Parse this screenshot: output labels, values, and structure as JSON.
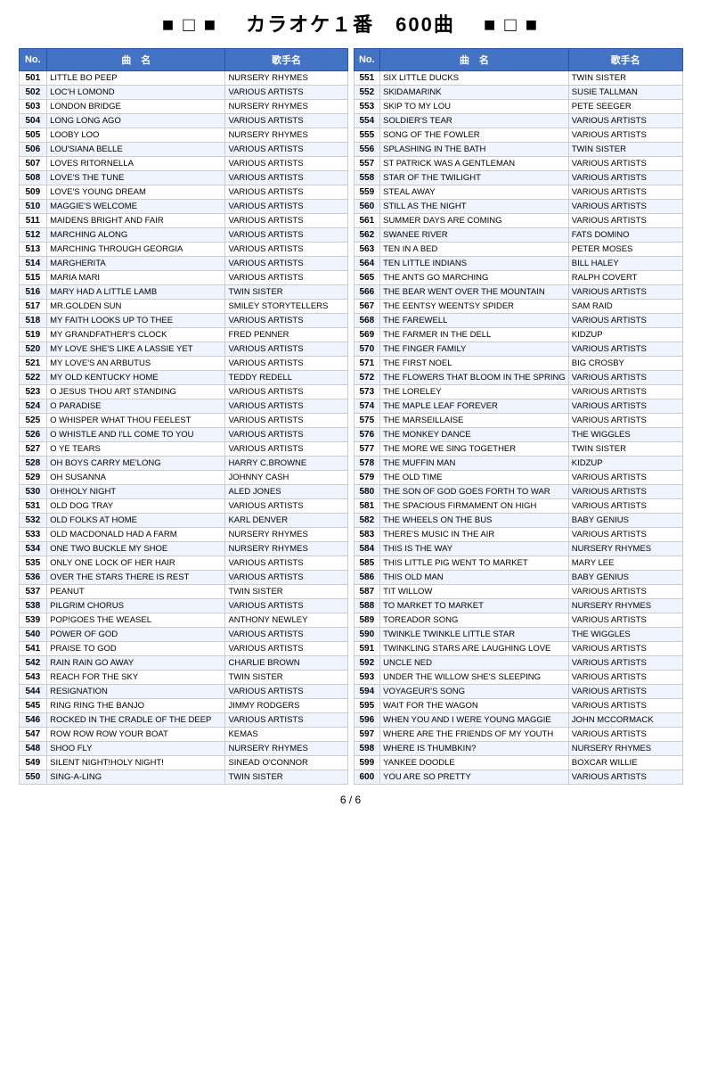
{
  "header": {
    "title": "カラオケ１番　600曲",
    "symbols_left": "■ □ ■",
    "symbols_right": "■ □ ■"
  },
  "footer": {
    "page": "6 / 6"
  },
  "columns": {
    "no": "No.",
    "song": "曲　名",
    "artist": "歌手名"
  },
  "left_table": [
    {
      "no": "501",
      "song": "LITTLE BO PEEP",
      "artist": "NURSERY RHYMES"
    },
    {
      "no": "502",
      "song": "LOC'H LOMOND",
      "artist": "VARIOUS ARTISTS"
    },
    {
      "no": "503",
      "song": "LONDON BRIDGE",
      "artist": "NURSERY RHYMES"
    },
    {
      "no": "504",
      "song": "LONG LONG AGO",
      "artist": "VARIOUS ARTISTS"
    },
    {
      "no": "505",
      "song": "LOOBY LOO",
      "artist": "NURSERY RHYMES"
    },
    {
      "no": "506",
      "song": "LOU'SIANA BELLE",
      "artist": "VARIOUS ARTISTS"
    },
    {
      "no": "507",
      "song": "LOVES RITORNELLA",
      "artist": "VARIOUS ARTISTS"
    },
    {
      "no": "508",
      "song": "LOVE'S THE TUNE",
      "artist": "VARIOUS ARTISTS"
    },
    {
      "no": "509",
      "song": "LOVE'S YOUNG DREAM",
      "artist": "VARIOUS ARTISTS"
    },
    {
      "no": "510",
      "song": "MAGGIE'S WELCOME",
      "artist": "VARIOUS ARTISTS"
    },
    {
      "no": "511",
      "song": "MAIDENS BRIGHT AND FAIR",
      "artist": "VARIOUS ARTISTS"
    },
    {
      "no": "512",
      "song": "MARCHING ALONG",
      "artist": "VARIOUS ARTISTS"
    },
    {
      "no": "513",
      "song": "MARCHING THROUGH GEORGIA",
      "artist": "VARIOUS ARTISTS"
    },
    {
      "no": "514",
      "song": "MARGHERITA",
      "artist": "VARIOUS ARTISTS"
    },
    {
      "no": "515",
      "song": "MARIA MARI",
      "artist": "VARIOUS ARTISTS"
    },
    {
      "no": "516",
      "song": "MARY HAD A LITTLE LAMB",
      "artist": "TWIN SISTER"
    },
    {
      "no": "517",
      "song": "MR.GOLDEN SUN",
      "artist": "SMILEY STORYTELLERS"
    },
    {
      "no": "518",
      "song": "MY FAITH LOOKS UP TO THEE",
      "artist": "VARIOUS ARTISTS"
    },
    {
      "no": "519",
      "song": "MY GRANDFATHER'S CLOCK",
      "artist": "FRED PENNER"
    },
    {
      "no": "520",
      "song": "MY LOVE SHE'S LIKE A LASSIE YET",
      "artist": "VARIOUS ARTISTS"
    },
    {
      "no": "521",
      "song": "MY LOVE'S AN ARBUTUS",
      "artist": "VARIOUS ARTISTS"
    },
    {
      "no": "522",
      "song": "MY OLD KENTUCKY HOME",
      "artist": "TEDDY REDELL"
    },
    {
      "no": "523",
      "song": "O JESUS THOU ART STANDING",
      "artist": "VARIOUS ARTISTS"
    },
    {
      "no": "524",
      "song": "O PARADISE",
      "artist": "VARIOUS ARTISTS"
    },
    {
      "no": "525",
      "song": "O WHISPER WHAT THOU FEELEST",
      "artist": "VARIOUS ARTISTS"
    },
    {
      "no": "526",
      "song": "O WHISTLE AND I'LL COME TO YOU",
      "artist": "VARIOUS ARTISTS"
    },
    {
      "no": "527",
      "song": "O YE TEARS",
      "artist": "VARIOUS ARTISTS"
    },
    {
      "no": "528",
      "song": "OH BOYS CARRY ME'LONG",
      "artist": "HARRY C.BROWNE"
    },
    {
      "no": "529",
      "song": "OH SUSANNA",
      "artist": "JOHNNY CASH"
    },
    {
      "no": "530",
      "song": "OH!HOLY NIGHT",
      "artist": "ALED JONES"
    },
    {
      "no": "531",
      "song": "OLD DOG TRAY",
      "artist": "VARIOUS ARTISTS"
    },
    {
      "no": "532",
      "song": "OLD FOLKS AT HOME",
      "artist": "KARL DENVER"
    },
    {
      "no": "533",
      "song": "OLD MACDONALD HAD A FARM",
      "artist": "NURSERY RHYMES"
    },
    {
      "no": "534",
      "song": "ONE TWO BUCKLE MY SHOE",
      "artist": "NURSERY RHYMES"
    },
    {
      "no": "535",
      "song": "ONLY ONE LOCK OF HER HAIR",
      "artist": "VARIOUS ARTISTS"
    },
    {
      "no": "536",
      "song": "OVER THE STARS THERE IS REST",
      "artist": "VARIOUS ARTISTS"
    },
    {
      "no": "537",
      "song": "PEANUT",
      "artist": "TWIN SISTER"
    },
    {
      "no": "538",
      "song": "PILGRIM CHORUS",
      "artist": "VARIOUS ARTISTS"
    },
    {
      "no": "539",
      "song": "POP!GOES THE WEASEL",
      "artist": "ANTHONY NEWLEY"
    },
    {
      "no": "540",
      "song": "POWER OF GOD",
      "artist": "VARIOUS ARTISTS"
    },
    {
      "no": "541",
      "song": "PRAISE TO GOD",
      "artist": "VARIOUS ARTISTS"
    },
    {
      "no": "542",
      "song": "RAIN RAIN GO AWAY",
      "artist": "CHARLIE BROWN"
    },
    {
      "no": "543",
      "song": "REACH FOR THE SKY",
      "artist": "TWIN SISTER"
    },
    {
      "no": "544",
      "song": "RESIGNATION",
      "artist": "VARIOUS ARTISTS"
    },
    {
      "no": "545",
      "song": "RING RING THE BANJO",
      "artist": "JIMMY RODGERS"
    },
    {
      "no": "546",
      "song": "ROCKED IN THE CRADLE OF THE DEEP",
      "artist": "VARIOUS ARTISTS"
    },
    {
      "no": "547",
      "song": "ROW ROW ROW YOUR BOAT",
      "artist": "KEMAS"
    },
    {
      "no": "548",
      "song": "SHOO FLY",
      "artist": "NURSERY RHYMES"
    },
    {
      "no": "549",
      "song": "SILENT NIGHT!HOLY NIGHT!",
      "artist": "SINEAD O'CONNOR"
    },
    {
      "no": "550",
      "song": "SING-A-LING",
      "artist": "TWIN SISTER"
    }
  ],
  "right_table": [
    {
      "no": "551",
      "song": "SIX LITTLE DUCKS",
      "artist": "TWIN SISTER"
    },
    {
      "no": "552",
      "song": "SKIDAMARINK",
      "artist": "SUSIE TALLMAN"
    },
    {
      "no": "553",
      "song": "SKIP TO MY LOU",
      "artist": "PETE SEEGER"
    },
    {
      "no": "554",
      "song": "SOLDIER'S TEAR",
      "artist": "VARIOUS ARTISTS"
    },
    {
      "no": "555",
      "song": "SONG OF THE FOWLER",
      "artist": "VARIOUS ARTISTS"
    },
    {
      "no": "556",
      "song": "SPLASHING IN THE BATH",
      "artist": "TWIN SISTER"
    },
    {
      "no": "557",
      "song": "ST PATRICK WAS A GENTLEMAN",
      "artist": "VARIOUS ARTISTS"
    },
    {
      "no": "558",
      "song": "STAR OF THE TWILIGHT",
      "artist": "VARIOUS ARTISTS"
    },
    {
      "no": "559",
      "song": "STEAL AWAY",
      "artist": "VARIOUS ARTISTS"
    },
    {
      "no": "560",
      "song": "STILL AS THE NIGHT",
      "artist": "VARIOUS ARTISTS"
    },
    {
      "no": "561",
      "song": "SUMMER DAYS ARE COMING",
      "artist": "VARIOUS ARTISTS"
    },
    {
      "no": "562",
      "song": "SWANEE RIVER",
      "artist": "FATS DOMINO"
    },
    {
      "no": "563",
      "song": "TEN IN A BED",
      "artist": "PETER MOSES"
    },
    {
      "no": "564",
      "song": "TEN LITTLE INDIANS",
      "artist": "BILL HALEY"
    },
    {
      "no": "565",
      "song": "THE ANTS GO MARCHING",
      "artist": "RALPH COVERT"
    },
    {
      "no": "566",
      "song": "THE BEAR WENT OVER THE MOUNTAIN",
      "artist": "VARIOUS ARTISTS"
    },
    {
      "no": "567",
      "song": "THE EENTSY WEENTSY SPIDER",
      "artist": "SAM RAID"
    },
    {
      "no": "568",
      "song": "THE FAREWELL",
      "artist": "VARIOUS ARTISTS"
    },
    {
      "no": "569",
      "song": "THE FARMER IN THE DELL",
      "artist": "KIDZUP"
    },
    {
      "no": "570",
      "song": "THE FINGER FAMILY",
      "artist": "VARIOUS ARTISTS"
    },
    {
      "no": "571",
      "song": "THE FIRST NOEL",
      "artist": "BIG CROSBY"
    },
    {
      "no": "572",
      "song": "THE FLOWERS THAT BLOOM IN THE SPRING",
      "artist": "VARIOUS ARTISTS"
    },
    {
      "no": "573",
      "song": "THE LORELEY",
      "artist": "VARIOUS ARTISTS"
    },
    {
      "no": "574",
      "song": "THE MAPLE LEAF FOREVER",
      "artist": "VARIOUS ARTISTS"
    },
    {
      "no": "575",
      "song": "THE MARSEILLAISE",
      "artist": "VARIOUS ARTISTS"
    },
    {
      "no": "576",
      "song": "THE MONKEY DANCE",
      "artist": "THE WIGGLES"
    },
    {
      "no": "577",
      "song": "THE MORE WE SING TOGETHER",
      "artist": "TWIN SISTER"
    },
    {
      "no": "578",
      "song": "THE MUFFIN MAN",
      "artist": "KIDZUP"
    },
    {
      "no": "579",
      "song": "THE OLD TIME",
      "artist": "VARIOUS ARTISTS"
    },
    {
      "no": "580",
      "song": "THE SON OF GOD GOES FORTH TO WAR",
      "artist": "VARIOUS ARTISTS"
    },
    {
      "no": "581",
      "song": "THE SPACIOUS FIRMAMENT ON HIGH",
      "artist": "VARIOUS ARTISTS"
    },
    {
      "no": "582",
      "song": "THE WHEELS ON THE BUS",
      "artist": "BABY GENIUS"
    },
    {
      "no": "583",
      "song": "THERE'S MUSIC IN THE AIR",
      "artist": "VARIOUS ARTISTS"
    },
    {
      "no": "584",
      "song": "THIS IS THE WAY",
      "artist": "NURSERY RHYMES"
    },
    {
      "no": "585",
      "song": "THIS LITTLE PIG WENT TO MARKET",
      "artist": "MARY LEE"
    },
    {
      "no": "586",
      "song": "THIS OLD MAN",
      "artist": "BABY GENIUS"
    },
    {
      "no": "587",
      "song": "TIT WILLOW",
      "artist": "VARIOUS ARTISTS"
    },
    {
      "no": "588",
      "song": "TO MARKET TO MARKET",
      "artist": "NURSERY RHYMES"
    },
    {
      "no": "589",
      "song": "TOREADOR SONG",
      "artist": "VARIOUS ARTISTS"
    },
    {
      "no": "590",
      "song": "TWINKLE TWINKLE LITTLE  STAR",
      "artist": "THE  WIGGLES"
    },
    {
      "no": "591",
      "song": "TWINKLING STARS ARE LAUGHING LOVE",
      "artist": "VARIOUS ARTISTS"
    },
    {
      "no": "592",
      "song": "UNCLE NED",
      "artist": "VARIOUS ARTISTS"
    },
    {
      "no": "593",
      "song": "UNDER THE WILLOW SHE'S SLEEPING",
      "artist": "VARIOUS ARTISTS"
    },
    {
      "no": "594",
      "song": "VOYAGEUR'S SONG",
      "artist": "VARIOUS ARTISTS"
    },
    {
      "no": "595",
      "song": "WAIT FOR THE WAGON",
      "artist": "VARIOUS ARTISTS"
    },
    {
      "no": "596",
      "song": "WHEN YOU AND I WERE YOUNG MAGGIE",
      "artist": "JOHN MCCORMACK"
    },
    {
      "no": "597",
      "song": "WHERE ARE THE FRIENDS OF MY YOUTH",
      "artist": "VARIOUS ARTISTS"
    },
    {
      "no": "598",
      "song": "WHERE IS THUMBKIN?",
      "artist": "NURSERY RHYMES"
    },
    {
      "no": "599",
      "song": "YANKEE DOODLE",
      "artist": "BOXCAR WILLIE"
    },
    {
      "no": "600",
      "song": "YOU ARE SO PRETTY",
      "artist": "VARIOUS ARTISTS"
    }
  ]
}
